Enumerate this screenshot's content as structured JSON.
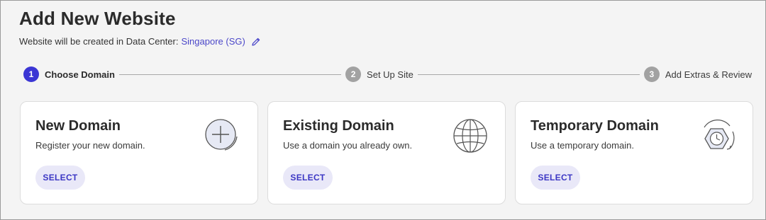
{
  "header": {
    "title": "Add New Website",
    "subtitle_prefix": "Website will be created in Data Center:",
    "data_center": "Singapore (SG)"
  },
  "steps": [
    {
      "number": "1",
      "label": "Choose Domain",
      "active": true
    },
    {
      "number": "2",
      "label": "Set Up Site",
      "active": false
    },
    {
      "number": "3",
      "label": "Add Extras & Review",
      "active": false
    }
  ],
  "cards": [
    {
      "title": "New Domain",
      "description": "Register your new domain.",
      "button": "SELECT",
      "icon": "plus-circle-icon"
    },
    {
      "title": "Existing Domain",
      "description": "Use a domain you already own.",
      "button": "SELECT",
      "icon": "globe-icon"
    },
    {
      "title": "Temporary Domain",
      "description": "Use a temporary domain.",
      "button": "SELECT",
      "icon": "timer-icon"
    }
  ],
  "colors": {
    "accent": "#3b36d4",
    "link": "#4b47c9",
    "button_bg": "#e9e8f8",
    "inactive_step": "#a2a2a2"
  }
}
